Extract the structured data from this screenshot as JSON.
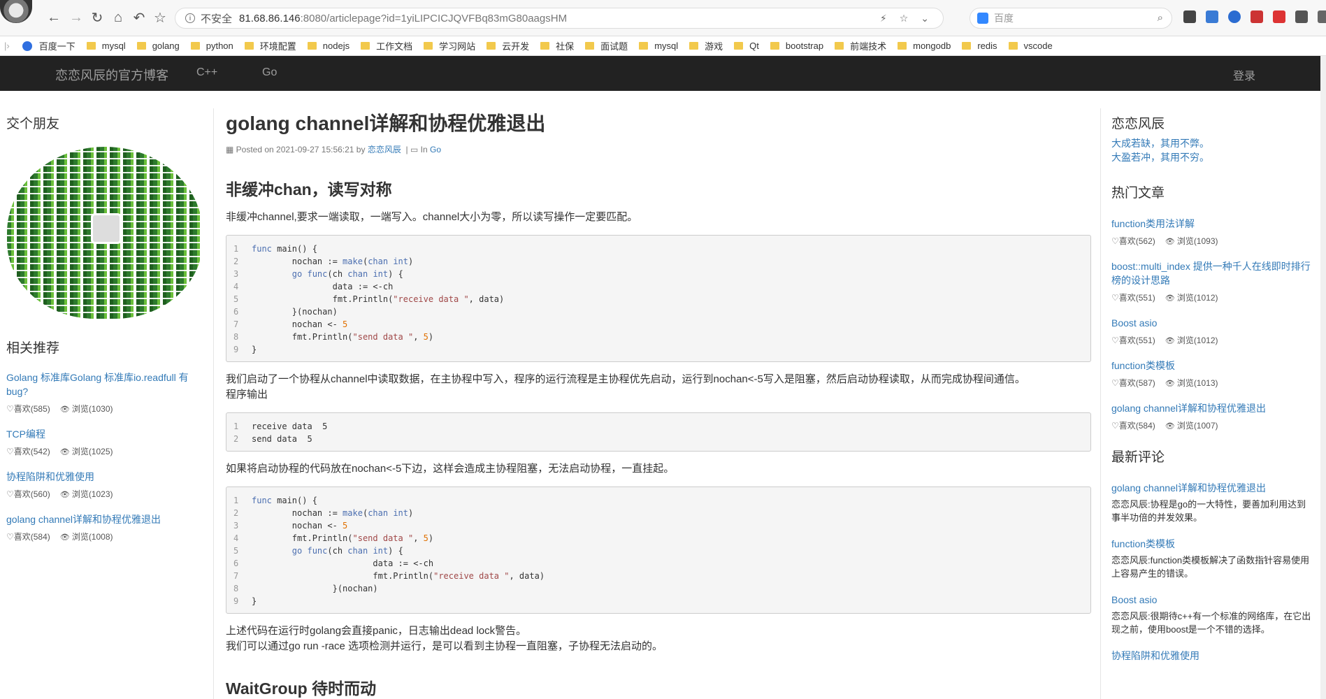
{
  "browser": {
    "security": "不安全",
    "host": "81.68.86.146",
    "path": ":8080/articlepage?id=1yiLIPCICJQVFBq83mG80aagsHM",
    "search_placeholder": "百度"
  },
  "bookmarks": [
    "百度一下",
    "mysql",
    "golang",
    "python",
    "环境配置",
    "nodejs",
    "工作文档",
    "学习网站",
    "云开发",
    "社保",
    "面试题",
    "mysql",
    "游戏",
    "Qt",
    "bootstrap",
    "前端技术",
    "mongodb",
    "redis",
    "vscode"
  ],
  "navbar": {
    "brand": "恋恋风辰的官方博客",
    "items": [
      "C++",
      "Go"
    ],
    "login": "登录"
  },
  "left": {
    "friends_title": "交个朋友",
    "rec_title": "相关推荐",
    "rec": [
      {
        "title": "Golang 标准库Golang 标准库io.readfull 有bug?",
        "likes": "喜欢(585)",
        "views": "浏览(1030)"
      },
      {
        "title": "TCP编程",
        "likes": "喜欢(542)",
        "views": "浏览(1025)"
      },
      {
        "title": "协程陷阱和优雅使用",
        "likes": "喜欢(560)",
        "views": "浏览(1023)"
      },
      {
        "title": "golang channel详解和协程优雅退出",
        "likes": "喜欢(584)",
        "views": "浏览(1008)"
      }
    ]
  },
  "article": {
    "title": "golang channel详解和协程优雅退出",
    "posted": "Posted on 2021-09-27 15:56:21 by",
    "author": "恋恋风辰",
    "in": "In",
    "category": "Go",
    "h1": "非缓冲chan，读写对称",
    "p1": "非缓冲channel,要求一端读取，一端写入。channel大小为零，所以读写操作一定要匹配。",
    "p2": "我们启动了一个协程从channel中读取数据，在主协程中写入，程序的运行流程是主协程优先启动，运行到nochan<-5写入是阻塞，然后启动协程读取，从而完成协程间通信。",
    "p2b": "程序输出",
    "p3": "如果将启动协程的代码放在nochan<-5下边，这样会造成主协程阻塞，无法启动协程，一直挂起。",
    "p4": "上述代码在运行时golang会直接panic，日志输出dead lock警告。",
    "p4b": "我们可以通过go run -race 选项检测并运行，是可以看到主协程一直阻塞，子协程无法启动的。",
    "h2": "WaitGroup 待时而动"
  },
  "right": {
    "author_title": "恋恋风辰",
    "motto1": "大成若缺，其用不弊。",
    "motto2": "大盈若冲，其用不穷。",
    "hot_title": "热门文章",
    "hot": [
      {
        "title": "function类用法详解",
        "likes": "喜欢(562)",
        "views": "浏览(1093)"
      },
      {
        "title": "boost::multi_index 提供一种千人在线即时排行榜的设计思路",
        "likes": "喜欢(551)",
        "views": "浏览(1012)"
      },
      {
        "title": "Boost asio",
        "likes": "喜欢(551)",
        "views": "浏览(1012)"
      },
      {
        "title": "function类模板",
        "likes": "喜欢(587)",
        "views": "浏览(1013)"
      },
      {
        "title": "golang channel详解和协程优雅退出",
        "likes": "喜欢(584)",
        "views": "浏览(1007)"
      }
    ],
    "comments_title": "最新评论",
    "comments": [
      {
        "title": "golang channel详解和协程优雅退出",
        "text": "恋恋风辰:协程是go的一大特性，要善加利用达到事半功倍的并发效果。"
      },
      {
        "title": "function类模板",
        "text": "恋恋风辰:function类模板解决了函数指针容易使用上容易产生的错误。"
      },
      {
        "title": "Boost asio",
        "text": "恋恋风辰:很期待c++有一个标准的网络库，在它出现之前，使用boost是一个不错的选择。"
      },
      {
        "title": "协程陷阱和优雅使用",
        "text": ""
      }
    ]
  }
}
